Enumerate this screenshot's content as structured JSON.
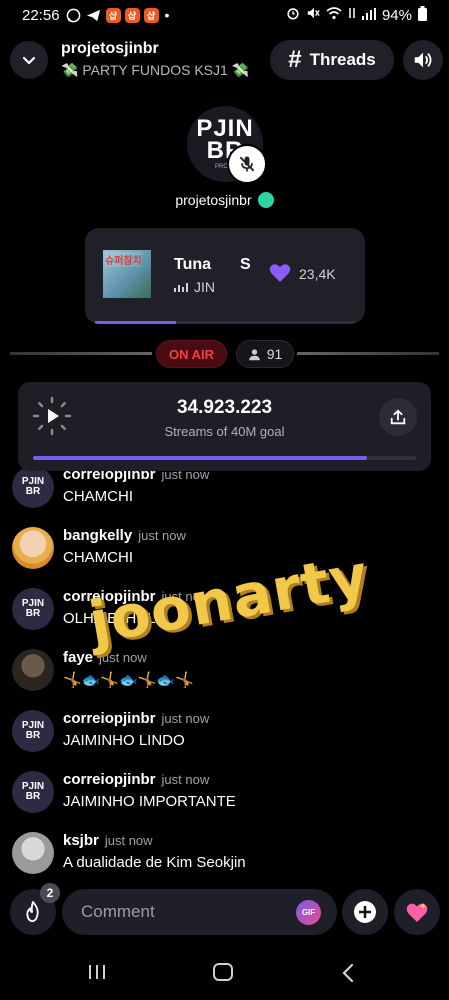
{
  "status_bar": {
    "time": "22:56",
    "battery": "94%",
    "app_badges": [
      "샵",
      "샵",
      "샵"
    ]
  },
  "header": {
    "title": "projetosjinbr",
    "subtitle": "💸 PARTY FUNDOS KSJ1 💸",
    "threads_label": "Threads"
  },
  "host": {
    "name": "projetosjinbr",
    "avatar_text": "PJIN BR",
    "avatar_sub": "PROJE"
  },
  "music": {
    "title": "Tuna",
    "title_suffix": "S",
    "artist": "JIN",
    "likes": "23,4K",
    "album_text": "슈퍼참치",
    "progress": 0.31,
    "accent": "#7b5cf0"
  },
  "live": {
    "on_air_label": "ON AIR",
    "listeners": "91"
  },
  "streams": {
    "count": "34.923.223",
    "goal_label": "Streams of 40M goal",
    "progress": 0.873
  },
  "chat": [
    {
      "user": "correiopjinbr",
      "time": "just now",
      "text": "CHAMCHI",
      "avatar": "logo"
    },
    {
      "user": "bangkelly",
      "time": "just now",
      "text": "CHAMCHI",
      "avatar": "photo1"
    },
    {
      "user": "correiopjinbr",
      "time": "just now",
      "text": "OLHA ELHHLIL",
      "avatar": "logo"
    },
    {
      "user": "faye",
      "time": "just now",
      "text": "🤸🐟🤸🐟🤸🐟🤸",
      "avatar": "photo2"
    },
    {
      "user": "correiopjinbr",
      "time": "just now",
      "text": "JAIMINHO LINDO",
      "avatar": "logo"
    },
    {
      "user": "correiopjinbr",
      "time": "just now",
      "text": "JAIMINHO IMPORTANTE",
      "avatar": "logo"
    },
    {
      "user": "ksjbr",
      "time": "just now",
      "text": "A dualidade de Kim Seokjin",
      "avatar": "photo3"
    }
  ],
  "avatar_logo_lines": [
    "PJIN",
    "BR"
  ],
  "watermark": "joonarty",
  "composer": {
    "placeholder": "Comment",
    "gif_label": "GIF",
    "fire_count": "2"
  }
}
